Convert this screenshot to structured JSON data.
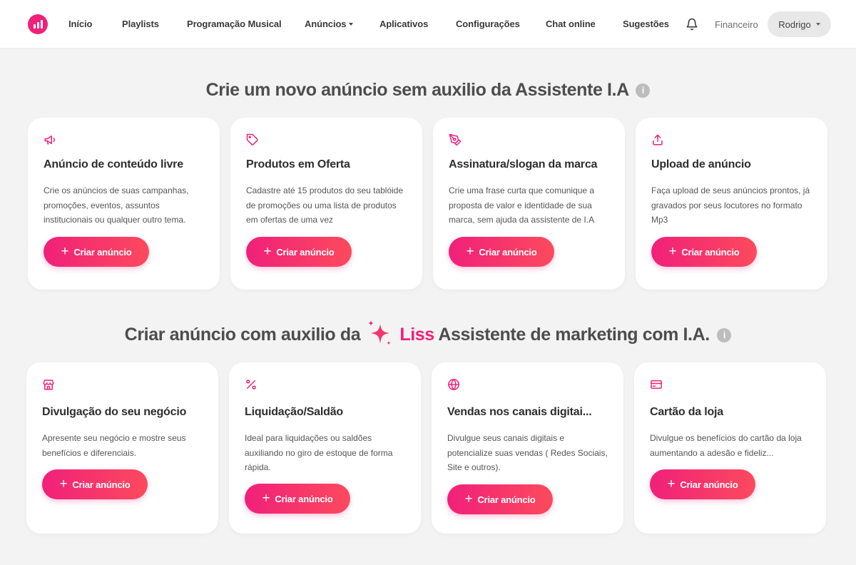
{
  "nav": {
    "items": [
      "Início",
      "Playlists",
      "Programação Musical",
      "Anúncios",
      "Aplicativos",
      "Configurações",
      "Chat online",
      "Sugestões"
    ],
    "financeiro": "Financeiro",
    "user": "Rodrigo"
  },
  "section1": {
    "title": "Crie um novo anúncio sem auxilio da Assistente I.A",
    "info": "i",
    "cards": [
      {
        "icon": "megaphone-icon",
        "title": "Anúncio de conteúdo livre",
        "desc": "Crie os anúncios de suas campanhas, promoções, eventos, assuntos institucionais ou qualquer outro tema.",
        "button": "Criar anúncio"
      },
      {
        "icon": "tag-icon",
        "title": "Produtos em Oferta",
        "desc": "Cadastre até 15 produtos do seu tablóide de promoções ou uma lista de produtos em ofertas de uma vez",
        "button": "Criar anúncio"
      },
      {
        "icon": "pen-icon",
        "title": "Assinatura/slogan da marca",
        "desc": "Crie uma frase curta que comunique a proposta de valor e identidade de sua marca, sem ajuda da assistente de I.A",
        "button": "Criar anúncio"
      },
      {
        "icon": "upload-icon",
        "title": "Upload de anúncio",
        "desc": "Faça upload de seus anúncios prontos, já gravados por seus locutores no formato Mp3",
        "button": "Criar anúncio"
      }
    ]
  },
  "section2": {
    "title_before": "Criar anúncio com auxilio da",
    "liss": "Liss",
    "title_after": "Assistente de marketing com I.A.",
    "info": "i",
    "cards": [
      {
        "icon": "store-icon",
        "title": "Divulgação do seu negócio",
        "desc": "Apresente seu negócio e mostre seus benefícios e diferenciais.",
        "button": "Criar anúncio"
      },
      {
        "icon": "percent-icon",
        "title": "Liquidação/Saldão",
        "desc": "Ideal para liquidações ou saldões auxiliando no giro de estoque de forma rápida.",
        "button": "Criar anúncio"
      },
      {
        "icon": "globe-icon",
        "title": "Vendas nos canais digitai...",
        "desc": "Divulgue seus canais digitais e potencialize suas vendas ( Redes Sociais, Site e outros).",
        "button": "Criar anúncio"
      },
      {
        "icon": "credit-card-icon",
        "title": "Cartão da loja",
        "desc": "Divulgue os benefícios do cartão da loja aumentando a adesão e fideliz...",
        "button": "Criar anúncio"
      }
    ]
  },
  "colors": {
    "accent": "#f0207a",
    "accent_end": "#fd4a5d",
    "background": "#f3f3f3"
  }
}
